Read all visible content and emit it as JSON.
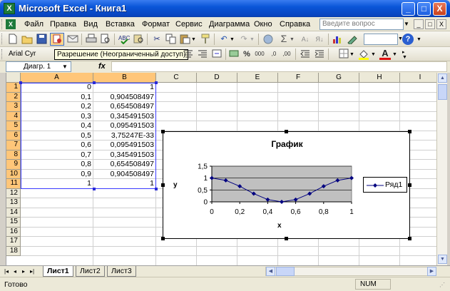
{
  "window": {
    "title": "Microsoft Excel - Книга1",
    "app_icon": "X",
    "btn_min": "_",
    "btn_max": "□",
    "btn_close": "X"
  },
  "menu": {
    "items": [
      "Файл",
      "Правка",
      "Вид",
      "Вставка",
      "Формат",
      "Сервис",
      "Диаграмма",
      "Окно",
      "Справка"
    ],
    "help_placeholder": "Введите вопрос",
    "doc_min": "_",
    "doc_restore": "□",
    "doc_close": "X"
  },
  "toolbar": {
    "font_name": "Arial Cyr",
    "tooltip": "Разрешение (Неограниченный доступ)",
    "sum": "Σ",
    "percent": "%",
    "comma": "000",
    "font_color_label": "A"
  },
  "formula_bar": {
    "name_box": "Диагр. 1",
    "fx": "fx",
    "formula": ""
  },
  "grid": {
    "columns": [
      "A",
      "B",
      "C",
      "D",
      "E",
      "F",
      "G",
      "H",
      "I"
    ],
    "rows": [
      "1",
      "2",
      "3",
      "4",
      "5",
      "6",
      "7",
      "8",
      "9",
      "10",
      "11",
      "12",
      "13",
      "14",
      "15",
      "16",
      "17",
      "18"
    ],
    "col_a": [
      "0",
      "0,1",
      "0,2",
      "0,3",
      "0,4",
      "0,5",
      "0,6",
      "0,7",
      "0,8",
      "0,9",
      "1"
    ],
    "col_b": [
      "1",
      "0,904508497",
      "0,654508497",
      "0,345491503",
      "0,095491503",
      "3,75247E-33",
      "0,095491503",
      "0,345491503",
      "0,654508497",
      "0,904508497",
      "1"
    ]
  },
  "chart_data": {
    "type": "line",
    "title": "График",
    "xlabel": "x",
    "ylabel": "y",
    "x": [
      0,
      0.1,
      0.2,
      0.3,
      0.4,
      0.5,
      0.6,
      0.7,
      0.8,
      0.9,
      1
    ],
    "series": [
      {
        "name": "Ряд1",
        "values": [
          1,
          0.904508497,
          0.654508497,
          0.345491503,
          0.095491503,
          3.75247e-33,
          0.095491503,
          0.345491503,
          0.654508497,
          0.904508497,
          1
        ]
      }
    ],
    "xlim": [
      0,
      1
    ],
    "ylim": [
      0,
      1.5
    ],
    "x_ticks": [
      "0",
      "0,2",
      "0,4",
      "0,6",
      "0,8",
      "1"
    ],
    "y_ticks": [
      "0",
      "0,5",
      "1",
      "1,5"
    ],
    "plot_area_color": "#c0c0c0",
    "series_color": "#000080",
    "legend": "right",
    "grid": true
  },
  "sheets": {
    "tabs": [
      "Лист1",
      "Лист2",
      "Лист3"
    ],
    "active": "Лист1"
  },
  "status": {
    "text": "Готово",
    "num": "NUM"
  }
}
